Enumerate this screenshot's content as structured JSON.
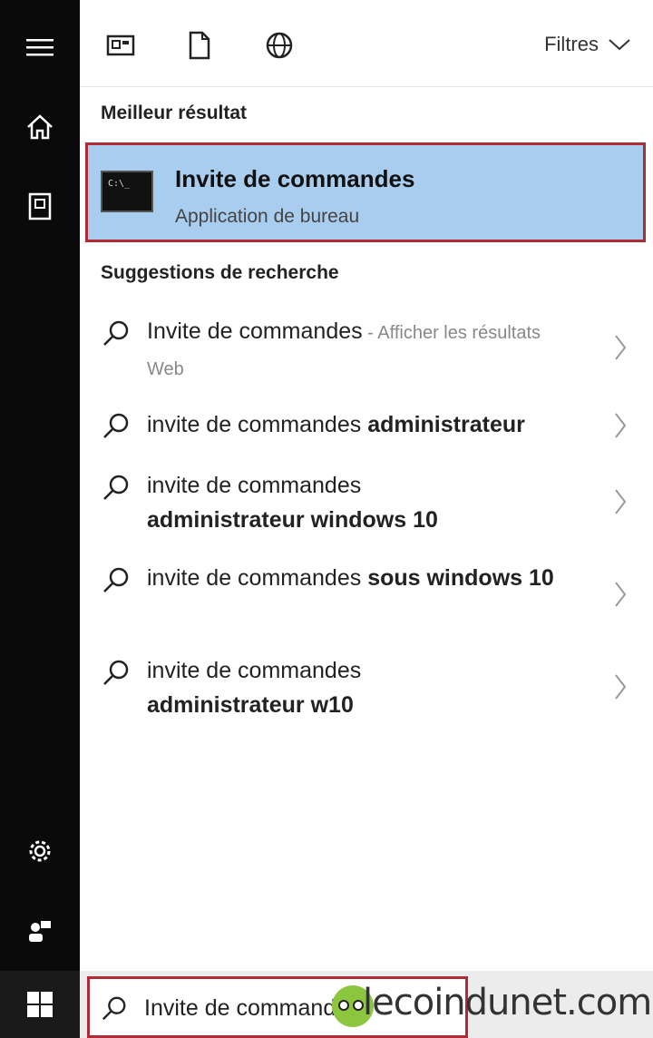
{
  "toolbar": {
    "filters_label": "Filtres",
    "icons": [
      "apps-icon",
      "document-icon",
      "web-icon"
    ]
  },
  "best_match": {
    "section_title": "Meilleur résultat",
    "title": "Invite de commandes",
    "subtitle": "Application de bureau",
    "icon_text": "C:\\_"
  },
  "suggestions": {
    "section_title": "Suggestions de recherche",
    "items": [
      {
        "normal": "Invite de commandes",
        "bold": "",
        "muted": " - Afficher les résultats Web"
      },
      {
        "normal": "invite de commandes ",
        "bold": "administrateur",
        "muted": ""
      },
      {
        "normal": "invite de commandes ",
        "bold": "administrateur windows 10",
        "muted": ""
      },
      {
        "normal": "invite de commandes ",
        "bold": "sous windows 10",
        "muted": ""
      },
      {
        "normal": "invite de commandes ",
        "bold": "administrateur w10",
        "muted": ""
      }
    ]
  },
  "search": {
    "value": "Invite de commandes"
  },
  "watermark": {
    "text": "lecoindunet.com"
  },
  "colors": {
    "rail_bg": "#0a0a0a",
    "highlight_bg": "#a9cdee",
    "annotation_border": "#b02a37"
  }
}
